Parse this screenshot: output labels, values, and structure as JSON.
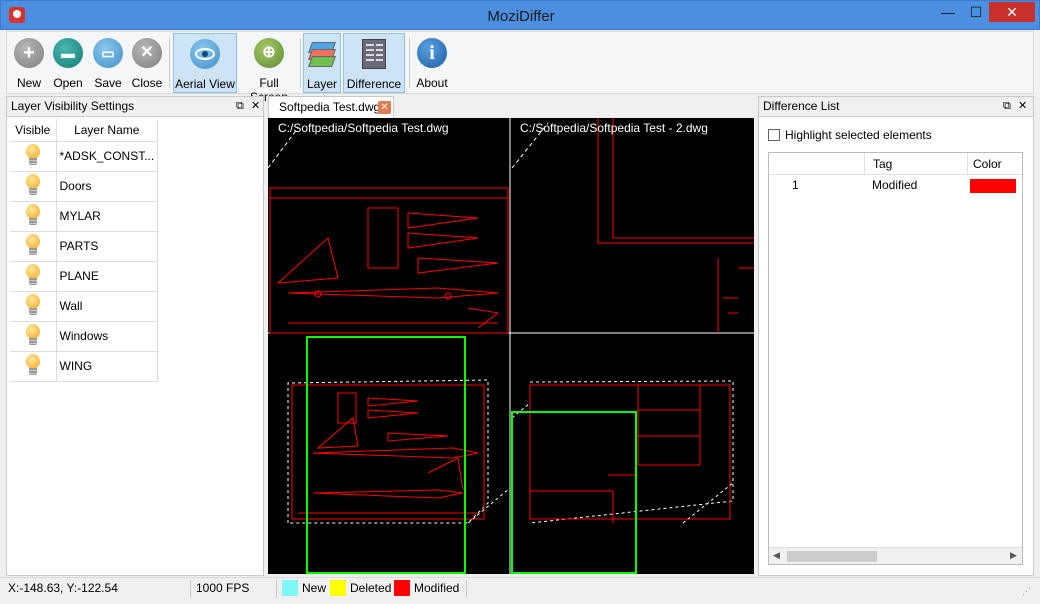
{
  "window": {
    "title": "MoziDiffer",
    "minimize": "—",
    "maximize": "☐",
    "close": "✕"
  },
  "toolbar": {
    "new": "New",
    "open": "Open",
    "save": "Save",
    "close": "Close",
    "aerial_view": "Aerial View",
    "full_screen": "Full Screen",
    "layer": "Layer",
    "difference": "Difference",
    "about": "About"
  },
  "layer_panel": {
    "title": "Layer Visibility Settings",
    "columns": {
      "visible": "Visible",
      "name": "Layer Name"
    },
    "layers": [
      {
        "name": "*ADSK_CONST..."
      },
      {
        "name": "Doors"
      },
      {
        "name": "MYLAR"
      },
      {
        "name": "PARTS"
      },
      {
        "name": "PLANE"
      },
      {
        "name": "Wall"
      },
      {
        "name": "Windows"
      },
      {
        "name": "WING"
      }
    ]
  },
  "document": {
    "tab_label": "Softpedia Test.dwg",
    "left_file": "C:/Softpedia/Softpedia Test.dwg",
    "right_file": "C:/Softpedia/Softpedia Test - 2.dwg"
  },
  "difference_panel": {
    "title": "Difference List",
    "highlight_label": "Highlight selected elements",
    "columns": {
      "tag": "Tag",
      "color": "Color"
    },
    "rows": [
      {
        "index": "1",
        "tag": "Modified",
        "color": "#ff0000"
      }
    ]
  },
  "status": {
    "coords": "X:-148.63, Y:-122.54",
    "fps": "1000 FPS",
    "legend": [
      {
        "label": "New",
        "color": "#7ff7f7"
      },
      {
        "label": "Deleted",
        "color": "#ffff00"
      },
      {
        "label": "Modified",
        "color": "#ff0000"
      }
    ]
  },
  "colors": {
    "accent_title": "#4a8fe0",
    "highlight_frame": "#00ff00",
    "drawing_lines": "#ff0000"
  }
}
